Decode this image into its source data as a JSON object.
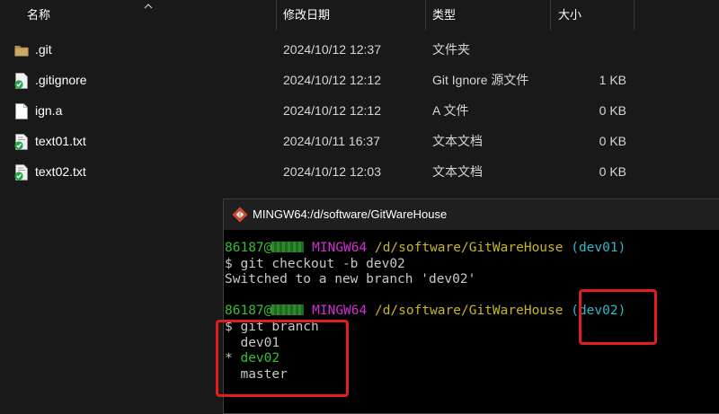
{
  "explorer": {
    "columns": {
      "name": "名称",
      "modified": "修改日期",
      "type": "类型",
      "size": "大小"
    },
    "files": [
      {
        "icon": "folder-icon",
        "name": ".git",
        "modified": "2024/10/12 12:37",
        "type": "文件夹",
        "size": ""
      },
      {
        "icon": "text-file-check-icon",
        "name": ".gitignore",
        "modified": "2024/10/12 12:12",
        "type": "Git Ignore 源文件",
        "size": "1 KB"
      },
      {
        "icon": "blank-file-icon",
        "name": "ign.a",
        "modified": "2024/10/12 12:12",
        "type": "A 文件",
        "size": "0 KB"
      },
      {
        "icon": "text-file-check-icon",
        "name": "text01.txt",
        "modified": "2024/10/11 16:37",
        "type": "文本文档",
        "size": "0 KB"
      },
      {
        "icon": "text-file-check-icon",
        "name": "text02.txt",
        "modified": "2024/10/12 12:03",
        "type": "文本文档",
        "size": "0 KB"
      }
    ]
  },
  "terminal": {
    "title": "MINGW64:/d/software/GitWareHouse",
    "prompt_user": "86187@",
    "prompt_env": "MINGW64",
    "prompt_path": "/d/software/GitWareHouse",
    "branch_before": "(dev01)",
    "cmd_checkout": "$ git checkout -b dev02",
    "checkout_output": "Switched to a new branch 'dev02'",
    "branch_after": "(dev02)",
    "cmd_branch": "$ git branch",
    "branch_list": {
      "item1": "  dev01",
      "current_marker": "* ",
      "current": "dev02",
      "item3": "  master"
    }
  },
  "colors": {
    "highlight_box": "#e01e1e",
    "prompt_green": "#33bf33",
    "prompt_magenta": "#d12fd1",
    "prompt_yellow": "#c7b52a",
    "branch_cyan": "#2fb8c8"
  }
}
